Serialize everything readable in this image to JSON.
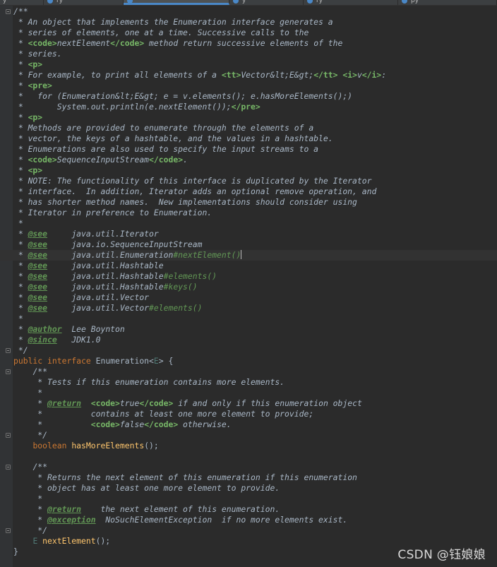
{
  "tabs": [
    {
      "label": "y"
    },
    {
      "label": "ry"
    },
    {
      "label": "y"
    },
    {
      "label": "ry"
    },
    {
      "label": "y"
    },
    {
      "label": "py"
    }
  ],
  "code": {
    "header_comment": [
      "/**",
      " * An object that implements the Enumeration interface generates a",
      " * series of elements, one at a time. Successive calls to the",
      " * ",
      "nextElement",
      " method return successive elements of the",
      " * series.",
      " * <p>",
      " * For example, to print all elements of a ",
      "Vector&lt;E&gt;",
      "v",
      ":",
      " * <pre>",
      " *   for (Enumeration&lt;E&gt; e = v.elements(); e.hasMoreElements();)",
      " *       System.out.println(e.nextElement());",
      " * Methods are provided to enumerate through the elements of a",
      " * vector, the keys of a hashtable, and the values in a hashtable.",
      " * Enumerations are also used to specify the input streams to a",
      "SequenceInputStream",
      ".",
      " * NOTE: The functionality of this interface is duplicated by the Iterator",
      " * interface.  In addition, Iterator adds an optional remove operation, and",
      " * has shorter method names.  New implementations should consider using",
      " * Iterator in preference to Enumeration.",
      " *"
    ],
    "see_tag": "@see",
    "see_refs": [
      {
        "cls": "java.util.Iterator",
        "member": ""
      },
      {
        "cls": "java.io.SequenceInputStream",
        "member": ""
      },
      {
        "cls": "java.util.Enumeration",
        "member": "#nextElement()"
      },
      {
        "cls": "java.util.Hashtable",
        "member": ""
      },
      {
        "cls": "java.util.Hashtable",
        "member": "#elements()"
      },
      {
        "cls": "java.util.Hashtable",
        "member": "#keys()"
      },
      {
        "cls": "java.util.Vector",
        "member": ""
      },
      {
        "cls": "java.util.Vector",
        "member": "#elements()"
      }
    ],
    "author_tag": "@author",
    "author_value": "Lee Boynton",
    "since_tag": "@since",
    "since_value": "JDK1.0",
    "comment_end": " */",
    "decl": {
      "kw_public": "public",
      "kw_interface": "interface",
      "name": "Enumeration",
      "type_param": "E",
      "open_brace": "{"
    },
    "m1_doc": {
      "open": "/**",
      "desc": " * Tests if this enumeration contains more elements.",
      "blank": " *",
      "return_tag": "@return",
      "true_text": "true",
      "return_text1": " if and only if this enumeration object",
      "return_text2": "          contains at least one more element to provide;",
      "false_text": "false",
      "return_text3": " otherwise.",
      "close": " */"
    },
    "m1": {
      "ret": "boolean",
      "name": "hasMoreElements",
      "tail": "();"
    },
    "m2_doc": {
      "open": "/**",
      "desc1": " * Returns the next element of this enumeration if this enumeration",
      "desc2": " * object has at least one more element to provide.",
      "blank": " *",
      "return_tag": "@return",
      "return_text": "    the next element of this enumeration.",
      "exception_tag": "@exception",
      "exception_type": "NoSuchElementException",
      "exception_text": "  if no more elements exist.",
      "close": " */"
    },
    "m2": {
      "ret": "E",
      "name": "nextElement",
      "tail": "();"
    },
    "close_brace": "}"
  },
  "watermark": "CSDN @钰娘娘",
  "colors": {
    "background": "#2b2b2b",
    "gutter": "#313335",
    "doc_comment": "#629755",
    "keyword": "#cc7832",
    "method": "#ffc66d",
    "text": "#a9b7c6"
  }
}
